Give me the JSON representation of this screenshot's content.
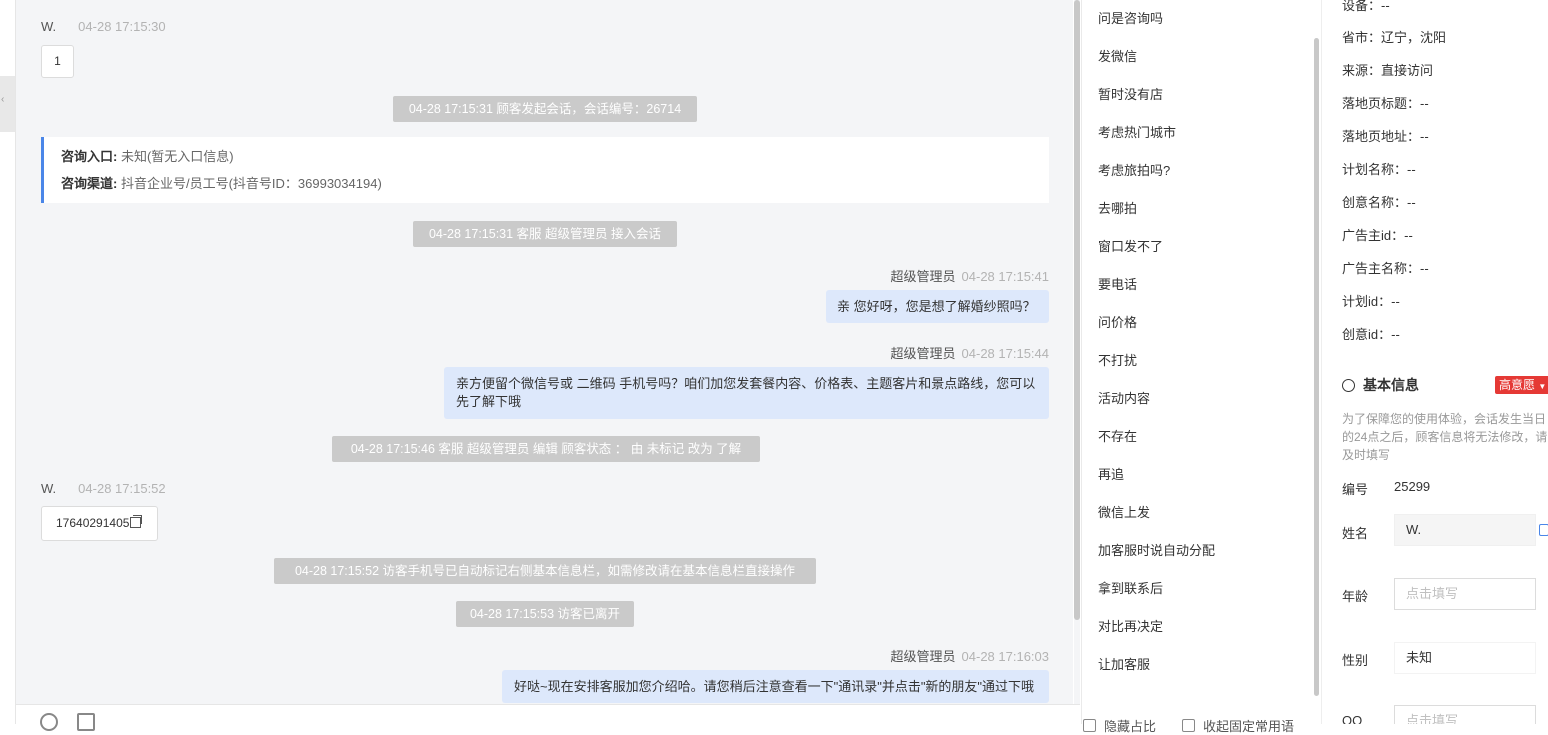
{
  "chat": {
    "messages": [
      {
        "sender": "W.",
        "time": "04-28 17:15:30",
        "text": "1"
      },
      {
        "system": "04-28 17:15:31 顾客发起会话，会话编号：26714"
      },
      {
        "system": "04-28 17:15:31 客服 超级管理员 接入会话"
      },
      {
        "sender": "超级管理员",
        "time": "04-28 17:15:41",
        "text": "亲 您好呀，您是想了解婚纱照吗？"
      },
      {
        "sender": "超级管理员",
        "time": "04-28 17:15:44",
        "text_line1": "亲方便留个微信号或 二维码 手机号吗？咱们加您发套餐内容、价格表、主题客片和景点路线，您可以",
        "text_line2": "先了解下哦"
      },
      {
        "system": "04-28 17:15:46 客服 超级管理员 编辑 顾客状态 ： 由 未标记 改为 了解"
      },
      {
        "sender": "W.",
        "time": "04-28 17:15:52",
        "text": "17640291405"
      },
      {
        "system": "04-28 17:15:52 访客手机号已自动标记右侧基本信息栏，如需修改请在基本信息栏直接操作"
      },
      {
        "system": "04-28 17:15:53 访客已离开"
      },
      {
        "sender": "超级管理员",
        "time": "04-28 17:16:03",
        "text": "好哒~现在安排客服加您介绍哈。请您稍后注意查看一下\"通讯录\"并点击\"新的朋友\"通过下哦"
      }
    ],
    "entry": {
      "label1": "咨询入口:",
      "value1": "未知(暂无入口信息)",
      "label2": "咨询渠道:",
      "value2": "抖音企业号/员工号(抖音号ID：36993034194)"
    }
  },
  "quick_replies": [
    "问是咨询吗",
    "发微信",
    "暂时没有店",
    "考虑热门城市",
    "考虑旅拍吗?",
    "去哪拍",
    "窗口发不了",
    "要电话",
    "问价格",
    "不打扰",
    "活动内容",
    "不存在",
    "再追",
    "微信上发",
    "加客服时说自动分配",
    "拿到联系后",
    "对比再决定",
    "让加客服"
  ],
  "quick_footer": {
    "opt1": "隐藏占比",
    "opt2": "收起固定常用语"
  },
  "info": {
    "device": "设备：--",
    "rows": [
      "省市：辽宁，沈阳",
      "来源：直接访问",
      "落地页标题：--",
      "落地页地址：--",
      "计划名称：--",
      "创意名称：--",
      "广告主id：--",
      "广告主名称：--",
      "计划id：--",
      "创意id：--"
    ],
    "section_title": "基本信息",
    "intent_badge": "高意愿",
    "tip": "为了保障您的使用体验，会话发生当日的24点之后，顾客信息将无法修改，请及时填写",
    "id_label": "编号",
    "id_value": "25299",
    "name_label": "姓名",
    "name_value": "W.",
    "age_label": "年龄",
    "age_placeholder": "点击填写",
    "gender_label": "性别",
    "gender_value": "未知",
    "qq_label": "QQ",
    "qq_placeholder": "点击填写"
  }
}
